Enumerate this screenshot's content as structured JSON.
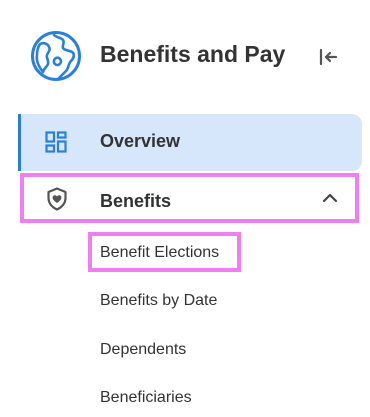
{
  "header": {
    "title": "Benefits and Pay",
    "app_icon": "globe-icon",
    "collapse_icon": "collapse-left-icon"
  },
  "nav": {
    "overview": {
      "label": "Overview",
      "icon": "dashboard-grid-icon"
    },
    "benefits": {
      "label": "Benefits",
      "icon": "shield-heart-icon",
      "expanded": true,
      "children": [
        "Benefit Elections",
        "Benefits by Date",
        "Dependents",
        "Beneficiaries"
      ]
    }
  },
  "colors": {
    "accent": "#2a7fdb",
    "selected_bg": "#d7e7fb",
    "highlight": "#f07ef0",
    "text": "#333333"
  }
}
